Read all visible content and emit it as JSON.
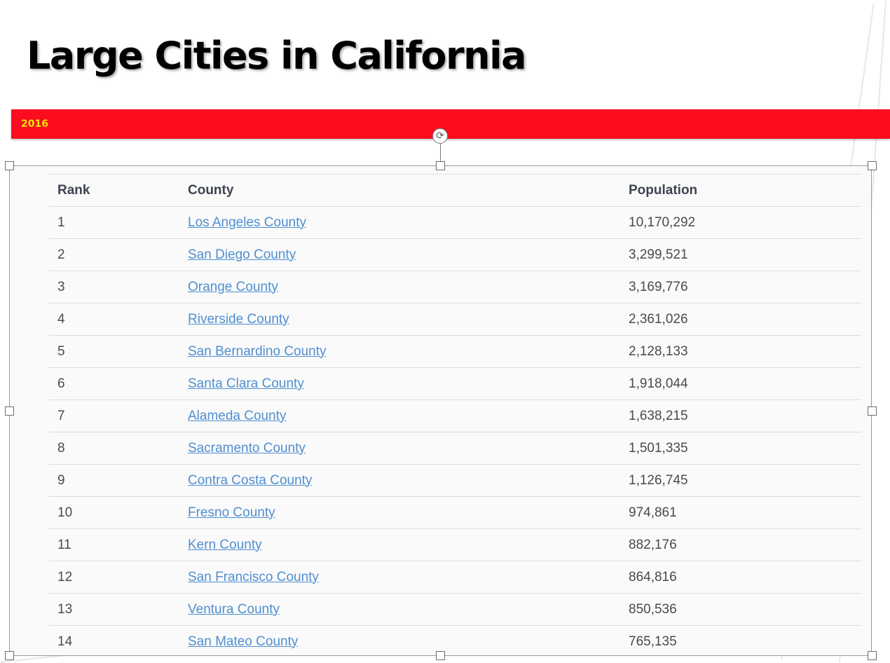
{
  "slide": {
    "title": "Large Cities in California",
    "year_label": "2016"
  },
  "colors": {
    "bar": "#fc0c1f",
    "year_text": "#f5e400",
    "link": "#4f8fd0"
  },
  "table": {
    "headers": {
      "rank": "Rank",
      "county": "County",
      "population": "Population"
    },
    "rows": [
      {
        "rank": "1",
        "county": "Los Angeles County",
        "population": "10,170,292"
      },
      {
        "rank": "2",
        "county": "San Diego County",
        "population": "3,299,521"
      },
      {
        "rank": "3",
        "county": "Orange County",
        "population": "3,169,776"
      },
      {
        "rank": "4",
        "county": "Riverside County",
        "population": "2,361,026"
      },
      {
        "rank": "5",
        "county": "San Bernardino County",
        "population": "2,128,133"
      },
      {
        "rank": "6",
        "county": "Santa Clara County",
        "population": "1,918,044"
      },
      {
        "rank": "7",
        "county": "Alameda County",
        "population": "1,638,215"
      },
      {
        "rank": "8",
        "county": "Sacramento County",
        "population": "1,501,335"
      },
      {
        "rank": "9",
        "county": "Contra Costa County",
        "population": "1,126,745"
      },
      {
        "rank": "10",
        "county": "Fresno County",
        "population": "974,861"
      },
      {
        "rank": "11",
        "county": "Kern County",
        "population": "882,176"
      },
      {
        "rank": "12",
        "county": "San Francisco County",
        "population": "864,816"
      },
      {
        "rank": "13",
        "county": "Ventura County",
        "population": "850,536"
      },
      {
        "rank": "14",
        "county": "San Mateo County",
        "population": "765,135"
      }
    ]
  },
  "icons": {
    "rotate": "rotate-icon"
  }
}
